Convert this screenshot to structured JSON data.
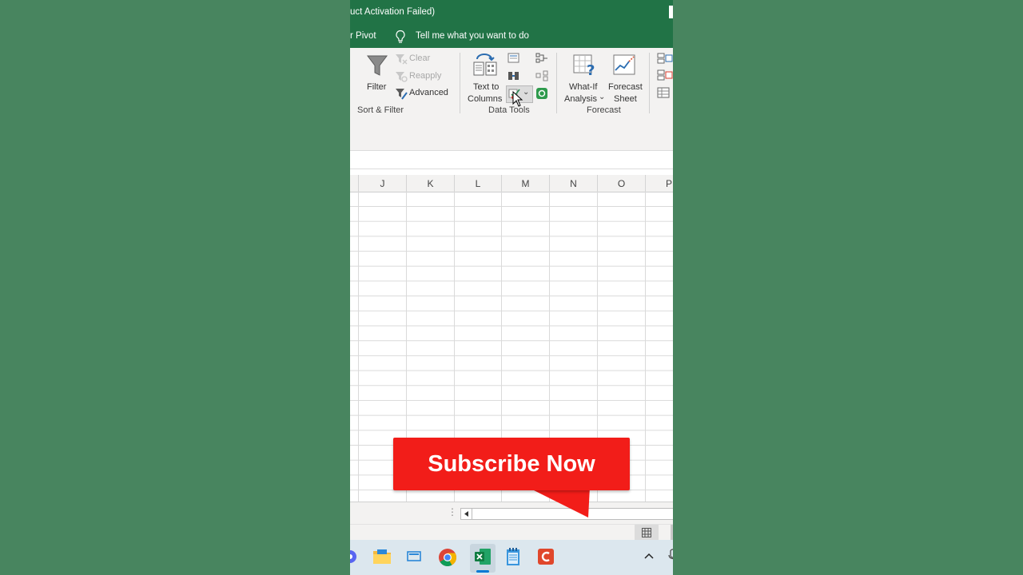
{
  "window": {
    "title": "uct Activation Failed)"
  },
  "tabs": {
    "pivot": "r Pivot",
    "tell_me": "Tell me what you want to do"
  },
  "ribbon": {
    "sort_filter": {
      "filter": "Filter",
      "clear": "Clear",
      "reapply": "Reapply",
      "advanced": "Advanced",
      "group": "Sort & Filter"
    },
    "data_tools": {
      "text_to": "Text to",
      "columns": "Columns",
      "group": "Data Tools"
    },
    "forecast": {
      "whatif": "What-If",
      "analysis": "Analysis",
      "forecast": "Forecast",
      "sheet": "Sheet",
      "group": "Forecast"
    }
  },
  "grid": {
    "columns": [
      "J",
      "K",
      "L",
      "M",
      "N",
      "O",
      "P"
    ]
  },
  "overlay": {
    "subscribe": "Subscribe Now"
  },
  "colors": {
    "excel_green": "#217346",
    "background_green": "#48855F",
    "subscribe_red": "#F21D19"
  },
  "taskbar": {
    "icons": [
      "app-icon",
      "file-explorer-icon",
      "window-icon",
      "chrome-icon",
      "excel-icon",
      "notepad-icon",
      "red-app-icon",
      "chevron-up-icon",
      "microphone-icon"
    ]
  }
}
